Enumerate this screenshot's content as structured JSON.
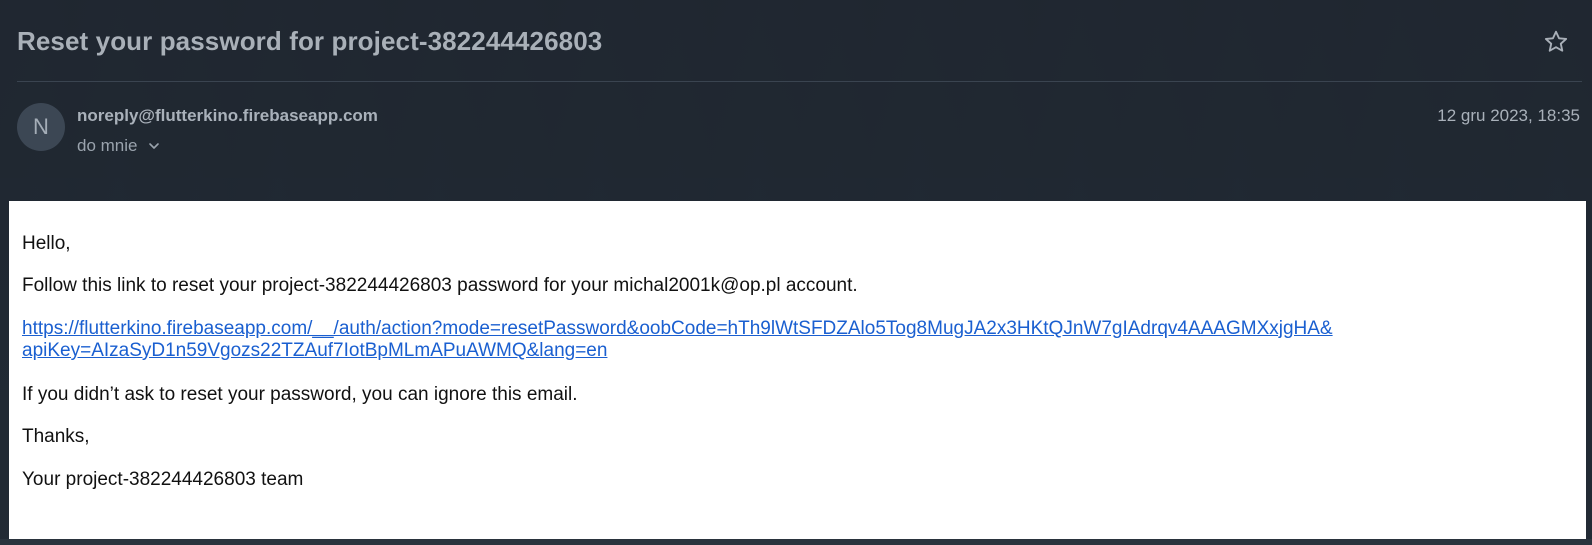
{
  "email": {
    "subject": "Reset your password for project-382244426803",
    "sender_initial": "N",
    "sender": "noreply@flutterkino.firebaseapp.com",
    "recipient": "do mnie",
    "date": "12 gru 2023, 18:35"
  },
  "message": {
    "greeting": "Hello,",
    "instruction": "Follow this link to reset your project-382244426803 password for your michal2001k@op.pl account.",
    "link_line1": "https://flutterkino.firebaseapp.com/__/auth/action?mode=resetPassword&oobCode=hTh9lWtSFDZAlo5Tog8MugJA2x3HKtQJnW7gIAdrqv4AAAGMXxjgHA&",
    "link_line2": "apiKey=AIzaSyD1n59Vgozs22TZAuf7IotBpMLmAPuAWMQ&lang=en",
    "ignore_note": "If you didn’t ask to reset your password, you can ignore this email.",
    "thanks": "Thanks,",
    "signature": "Your project-382244426803 team"
  },
  "icons": {
    "star": "star-icon",
    "chevron": "chevron-down-icon"
  },
  "colors": {
    "header_bg": "#202832",
    "link": "#1a5fd0",
    "body_bg": "#ffffff"
  }
}
